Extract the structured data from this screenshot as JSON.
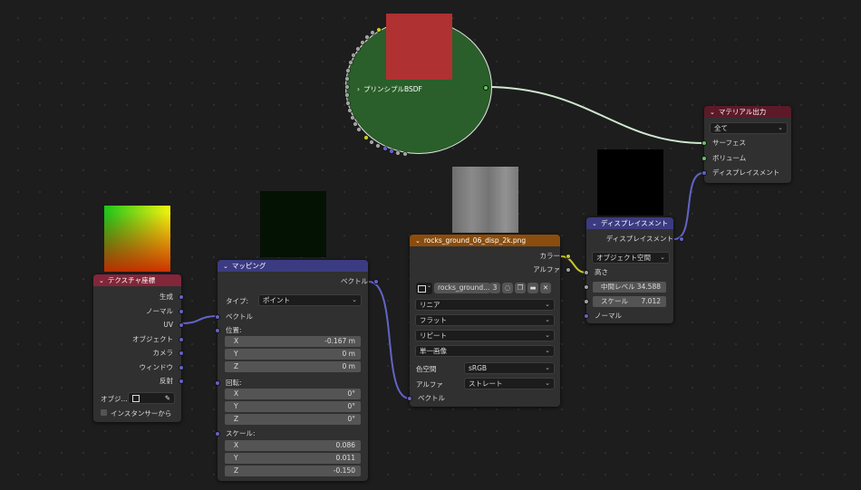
{
  "principled": {
    "label": "プリンシプルBSDF"
  },
  "material_output": {
    "title": "マテリアル出力",
    "target": "全て",
    "inputs": [
      "サーフェス",
      "ボリューム",
      "ディスプレイスメント"
    ]
  },
  "tex_coord": {
    "title": "テクスチャ座標",
    "outputs": [
      "生成",
      "ノーマル",
      "UV",
      "オブジェクト",
      "カメラ",
      "ウィンドウ",
      "反射"
    ],
    "object_label": "オブジ...",
    "instancer_label": "インスタンサーから"
  },
  "mapping": {
    "title": "マッピング",
    "output": "ベクトル",
    "type_label": "タイプ:",
    "type_value": "ポイント",
    "vector_in": "ベクトル",
    "location": {
      "label": "位置:",
      "x": "-0.167 m",
      "y": "0 m",
      "z": "0 m"
    },
    "rotation": {
      "label": "回転:",
      "x": "0°",
      "y": "0°",
      "z": "0°"
    },
    "scale": {
      "label": "スケール:",
      "x": "0.086",
      "y": "0.011",
      "z": "-0.150"
    },
    "axis": {
      "x": "X",
      "y": "Y",
      "z": "Z"
    }
  },
  "image_tex": {
    "title": "rocks_ground_06_disp_2k.png",
    "out_color": "カラー",
    "out_alpha": "アルファ",
    "image_name": "rocks_ground...",
    "users": "3",
    "interpolation": "リニア",
    "projection": "フラット",
    "extension": "リピート",
    "source": "単一画像",
    "colorspace_label": "色空間",
    "colorspace": "sRGB",
    "alpha_label": "アルファ",
    "alpha_mode": "ストレート",
    "vector_in": "ベクトル"
  },
  "displacement": {
    "title": "ディスプレイスメント",
    "output": "ディスプレイスメント",
    "space": "オブジェクト空間",
    "height": "高さ",
    "midlevel_label": "中間レベル",
    "midlevel": "34.588",
    "scale_label": "スケール",
    "scale": "7.012",
    "normal": "ノーマル"
  },
  "colors": {
    "node_bg": "#303030",
    "header_tex_coord": "#832639",
    "header_mapping": "#3b3b82",
    "header_image": "#8b4d0e",
    "header_displacement": "#3b3b82",
    "header_output": "#5c1a29",
    "bsdf_body": "#2a5e2a",
    "bsdf_preview": "#b03131",
    "link_vector": "#6363c7",
    "link_shader": "#cfe7cf",
    "link_color": "#c7c729"
  }
}
